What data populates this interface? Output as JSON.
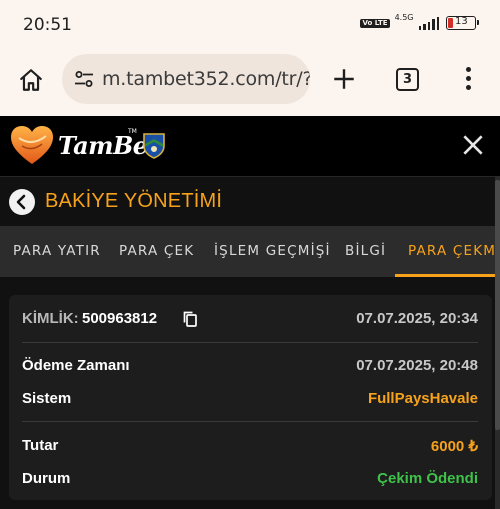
{
  "status_bar": {
    "time": "20:51",
    "network_label": "4.5G",
    "volte_label": "Vo LTE",
    "battery_level": "13",
    "icons": [
      "volte-icon",
      "signal-icon",
      "battery-icon"
    ]
  },
  "browser": {
    "url": "m.tambet352.com/tr/?",
    "tab_count": "3",
    "icons": [
      "home-icon",
      "site-settings-icon",
      "new-tab-icon",
      "tab-switcher-icon",
      "overflow-menu-icon"
    ]
  },
  "site": {
    "logo_text": "TamBet",
    "logo_tm": "TM",
    "close_icon": "close-icon"
  },
  "page": {
    "title": "BAKİYE YÖNETİMİ",
    "back_icon": "chevron-left-icon"
  },
  "tabs": [
    {
      "label": "PARA YATIR",
      "active": false
    },
    {
      "label": "PARA ÇEK",
      "active": false
    },
    {
      "label": "İŞLEM GEÇMİŞİ",
      "active": false
    },
    {
      "label": "BİLGİ",
      "active": false
    },
    {
      "label": "PARA ÇEKME",
      "active": true
    }
  ],
  "card": {
    "id_label": "KİMLİK:",
    "id_value": "500963812",
    "created_at": "07.07.2025, 20:34",
    "rows": [
      {
        "label": "Ödeme Zamanı",
        "value": "07.07.2025, 20:48"
      },
      {
        "label": "Sistem",
        "value": "FullPaysHavale"
      },
      {
        "label": "Tutar",
        "value": "6000 ₺"
      },
      {
        "label": "Durum",
        "value": "Çekim Ödendi"
      }
    ]
  },
  "colors": {
    "accent": "#f7a21b",
    "success": "#3ec24a",
    "card_bg": "#1d1d1d",
    "tabs_bg": "#2c2c2c"
  }
}
